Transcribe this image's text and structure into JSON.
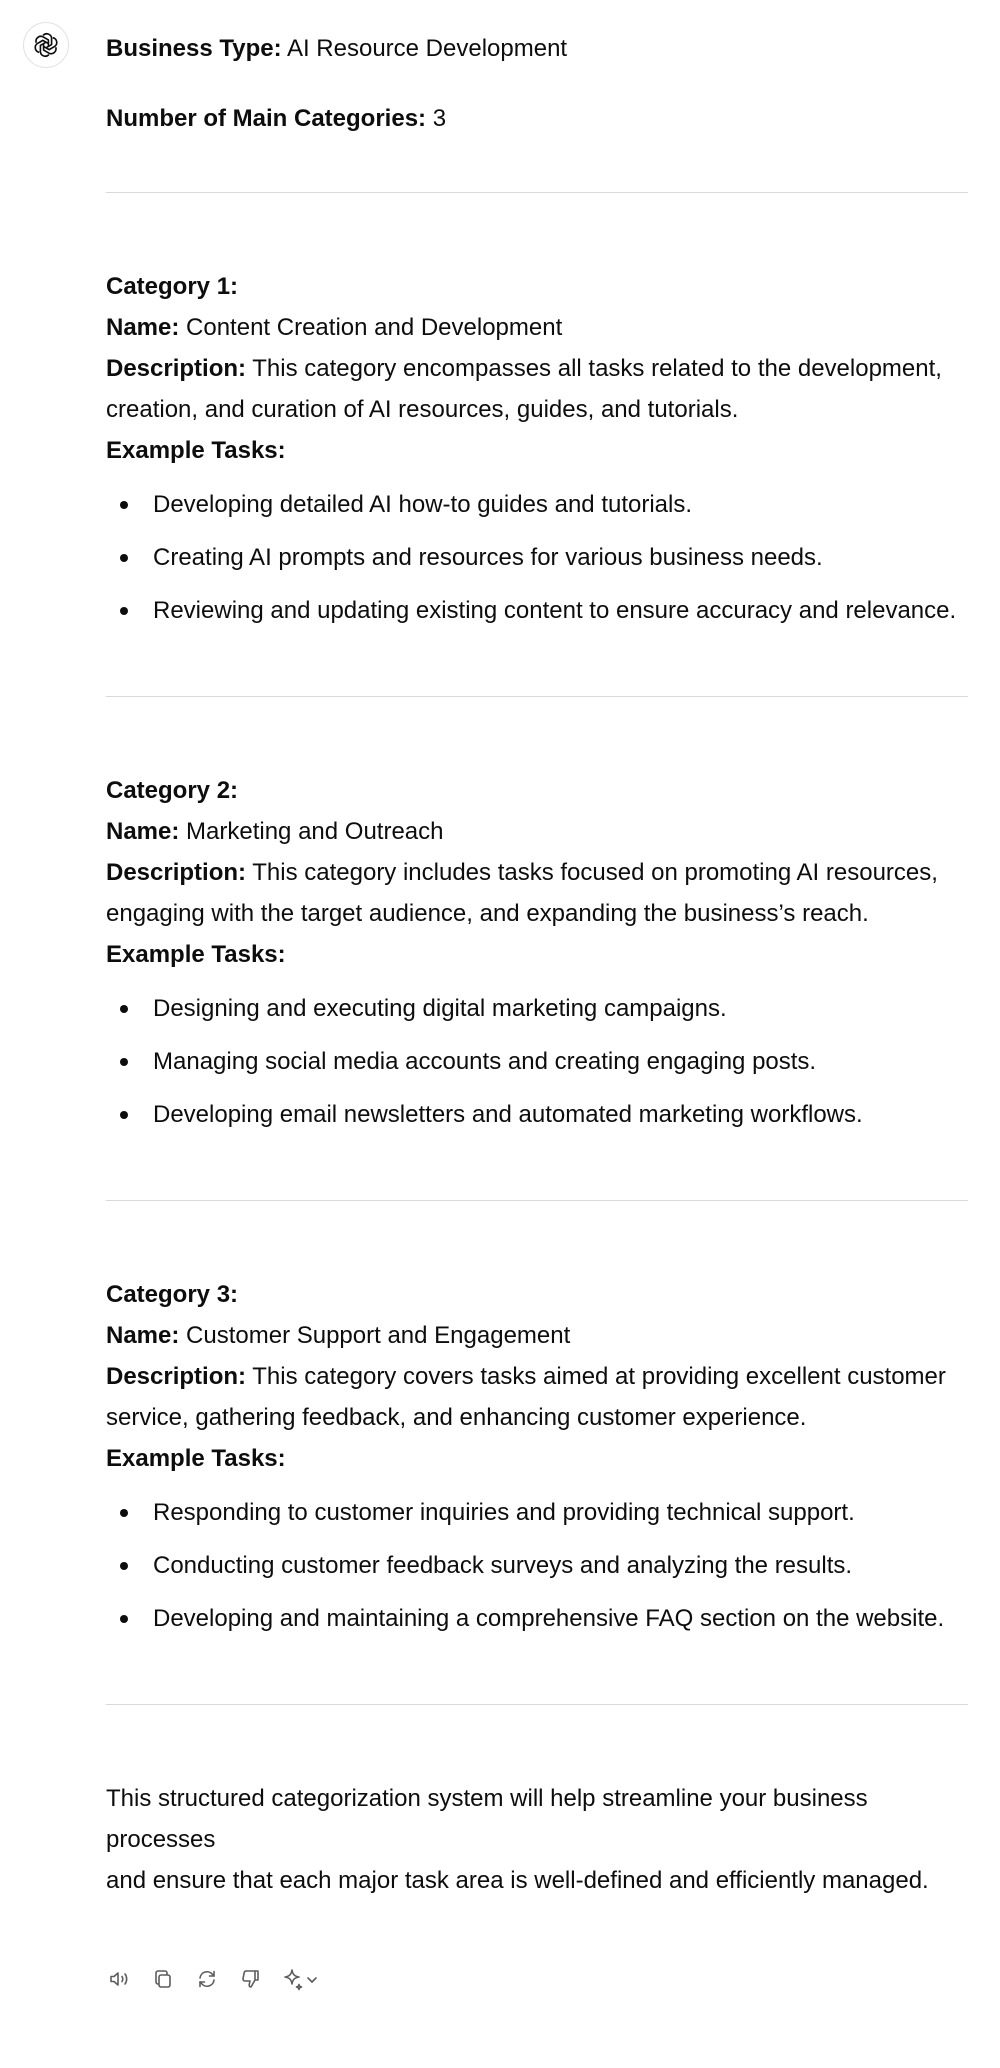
{
  "header": {
    "business_type_label": "Business Type:",
    "business_type_value": "AI Resource Development",
    "num_categories_label": "Number of Main Categories:",
    "num_categories_value": "3"
  },
  "labels": {
    "name": "Name:",
    "description": "Description:",
    "example_tasks": "Example Tasks:"
  },
  "categories": [
    {
      "title": "Category 1:",
      "name": "Content Creation and Development",
      "description_line1": "This category encompasses all tasks related to the development,",
      "description_line2": "creation, and curation of AI resources, guides, and tutorials.",
      "tasks": [
        "Developing detailed AI how-to guides and tutorials.",
        "Creating AI prompts and resources for various business needs.",
        "Reviewing and updating existing content to ensure accuracy and relevance."
      ]
    },
    {
      "title": "Category 2:",
      "name": "Marketing and Outreach",
      "description_line1": "This category includes tasks focused on promoting AI resources,",
      "description_line2": "engaging with the target audience, and expanding the business’s reach.",
      "tasks": [
        "Designing and executing digital marketing campaigns.",
        "Managing social media accounts and creating engaging posts.",
        "Developing email newsletters and automated marketing workflows."
      ]
    },
    {
      "title": "Category 3:",
      "name": "Customer Support and Engagement",
      "description_line1": "This category covers tasks aimed at providing excellent customer",
      "description_line2": "service, gathering feedback, and enhancing customer experience.",
      "tasks": [
        "Responding to customer inquiries and providing technical support.",
        "Conducting customer feedback surveys and analyzing the results.",
        "Developing and maintaining a comprehensive FAQ section on the website."
      ]
    }
  ],
  "closing": {
    "line1": "This structured categorization system will help streamline your business processes",
    "line2": "and ensure that each major task area is well-defined and efficiently managed."
  },
  "toolbar_icons": [
    "read-aloud-icon",
    "copy-icon",
    "regenerate-icon",
    "thumbs-down-icon",
    "sparkle-model-icon"
  ]
}
